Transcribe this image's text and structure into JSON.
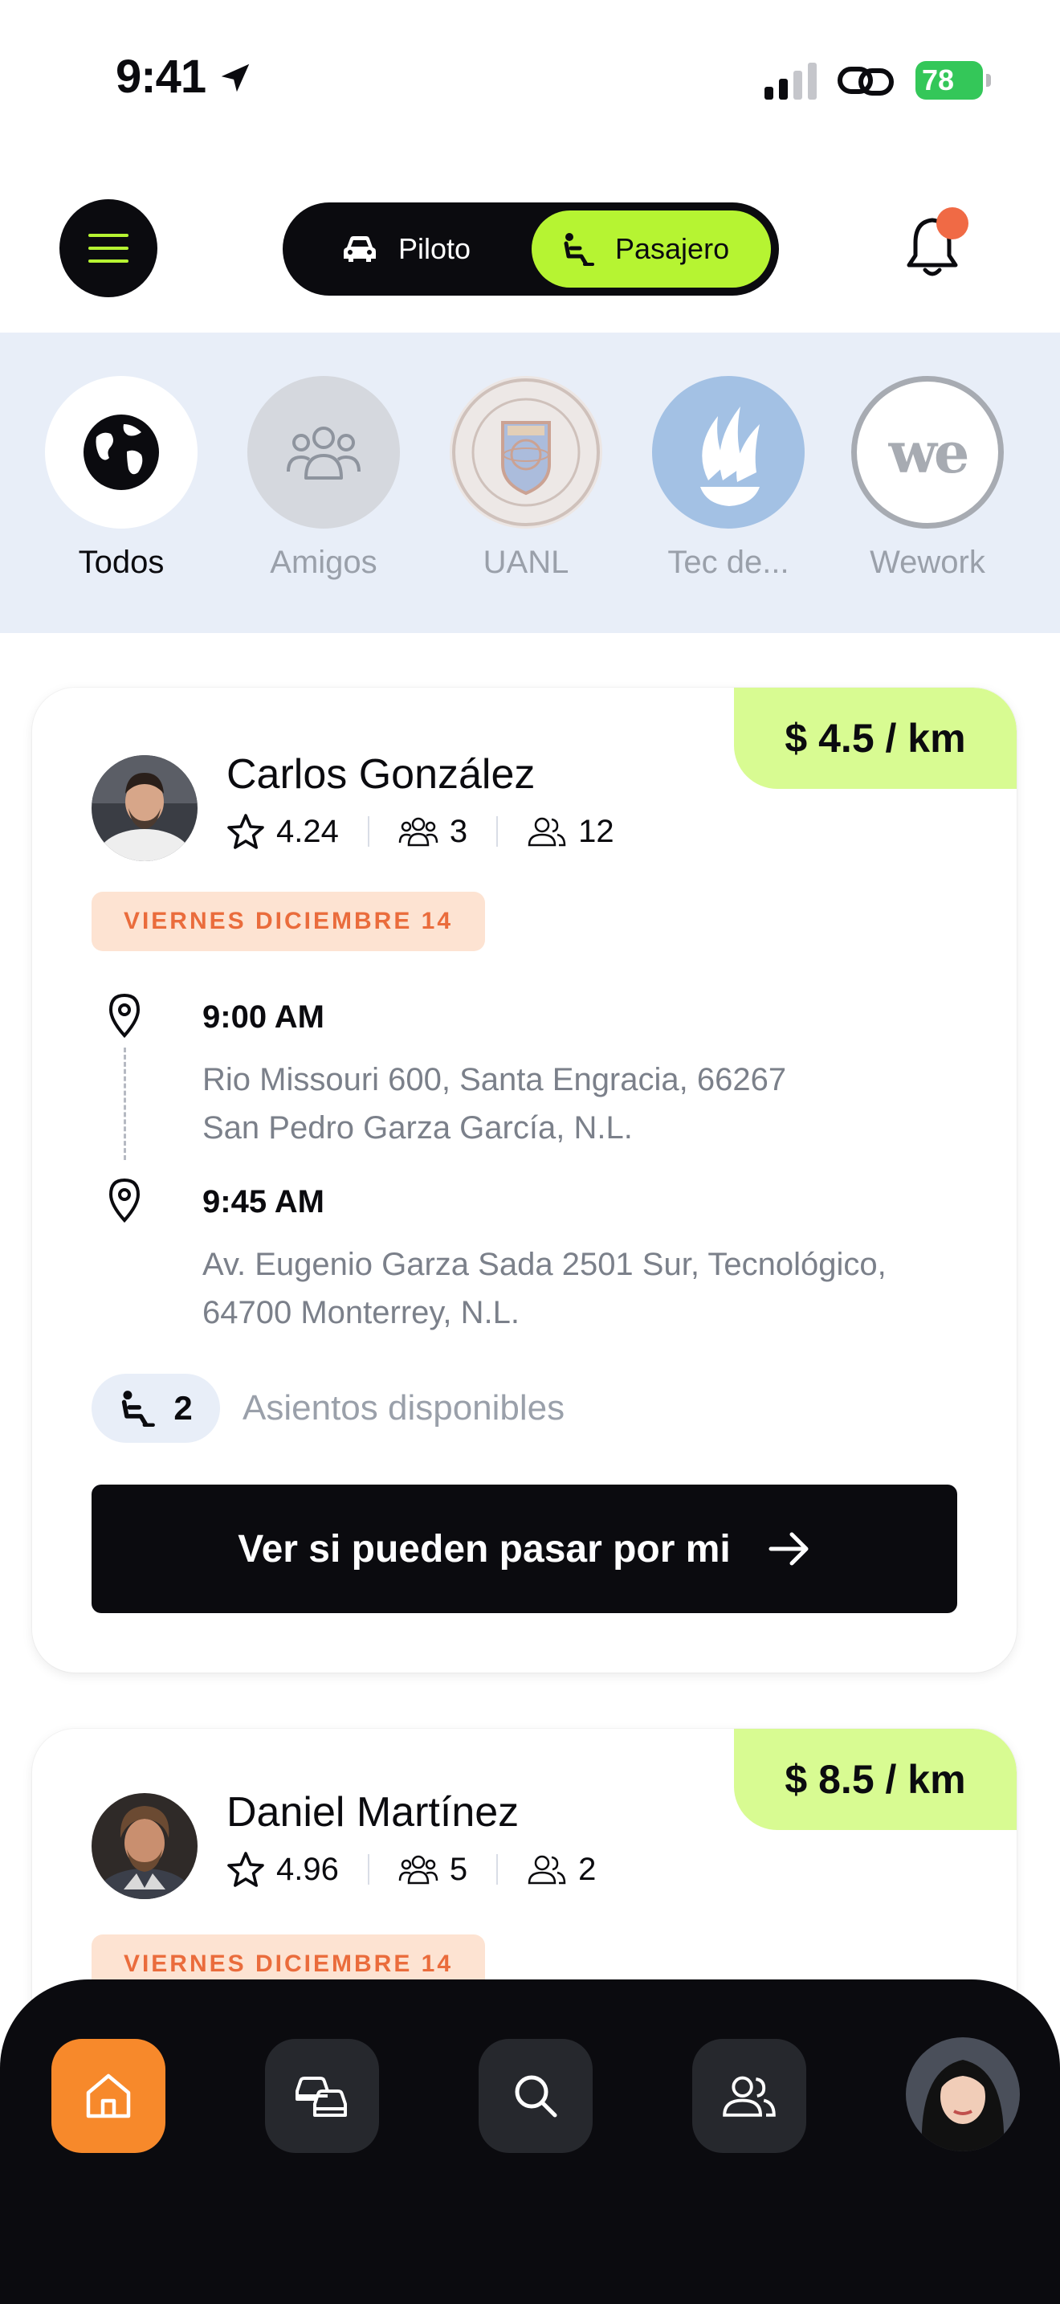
{
  "status_bar": {
    "time": "9:41",
    "battery": "78"
  },
  "header": {
    "toggle": {
      "piloto_label": "Piloto",
      "pasajero_label": "Pasajero",
      "selected": "Pasajero"
    }
  },
  "groups": [
    {
      "label": "Todos",
      "active": true
    },
    {
      "label": "Amigos",
      "active": false
    },
    {
      "label": "UANL",
      "active": false
    },
    {
      "label": "Tec de...",
      "active": false
    },
    {
      "label": "Wework",
      "active": false
    }
  ],
  "rides": [
    {
      "price": "$ 4.5 / km",
      "driver": "Carlos González",
      "rating": "4.24",
      "friends": "3",
      "mutual": "12",
      "date": "VIERNES DICIEMBRE 14",
      "pickup_time": "9:00 AM",
      "pickup_address_1": "Rio Missouri 600, Santa Engracia, 66267",
      "pickup_address_2": "San Pedro Garza García, N.L.",
      "dropoff_time": "9:45 AM",
      "dropoff_address_1": "Av. Eugenio Garza Sada 2501 Sur, Tecnológico,",
      "dropoff_address_2": "64700 Monterrey, N.L.",
      "seats": "2",
      "seats_label": "Asientos disponibles",
      "cta_label": "Ver si pueden pasar por mi"
    },
    {
      "price": "$ 8.5 / km",
      "driver": "Daniel Martínez",
      "rating": "4.96",
      "friends": "5",
      "mutual": "2",
      "date": "VIERNES DICIEMBRE 14"
    }
  ],
  "nav": {
    "items": [
      "home-icon",
      "cars-icon",
      "search-icon",
      "people-icon",
      "profile-avatar"
    ],
    "active": "home-icon"
  },
  "colors": {
    "accent_green": "#b6f432",
    "price_bg": "#d8fb92",
    "date_bg": "#fde3d2",
    "date_text": "#ea6c3c",
    "home_orange": "#f7892b",
    "group_bg": "#e8eef8"
  }
}
